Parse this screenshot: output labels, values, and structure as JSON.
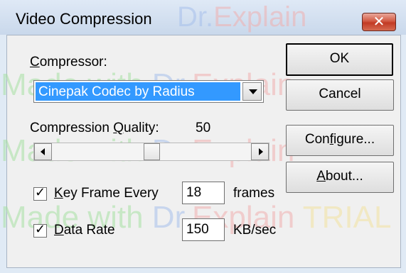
{
  "window": {
    "title": "Video Compression",
    "close_symbol": "✕"
  },
  "watermark": {
    "made": "Made",
    "with": "with",
    "dr": "Dr.",
    "explain": "Explain",
    "trial": "TRIAL"
  },
  "compressor": {
    "label_prefix": "",
    "label_accel": "C",
    "label_rest": "ompressor:",
    "selected": "Cinepak Codec by Radius"
  },
  "quality": {
    "label_prefix": "Compression ",
    "label_accel": "Q",
    "label_rest": "uality:",
    "value": "50",
    "slider_fraction": 0.5
  },
  "keyframe": {
    "checked": true,
    "check_glyph": "✓",
    "label_accel": "K",
    "label_rest": "ey Frame Every",
    "value": "18",
    "unit": "frames"
  },
  "datarate": {
    "checked": true,
    "check_glyph": "✓",
    "label_accel": "D",
    "label_rest": "ata Rate",
    "value": "150",
    "unit": "KB/sec"
  },
  "buttons": {
    "ok": "OK",
    "cancel": "Cancel",
    "configure_pre": "Con",
    "configure_accel": "f",
    "configure_rest": "igure...",
    "about_accel": "A",
    "about_rest": "bout..."
  },
  "colors": {
    "selection": "#3399ff",
    "close": "#c23a24"
  }
}
